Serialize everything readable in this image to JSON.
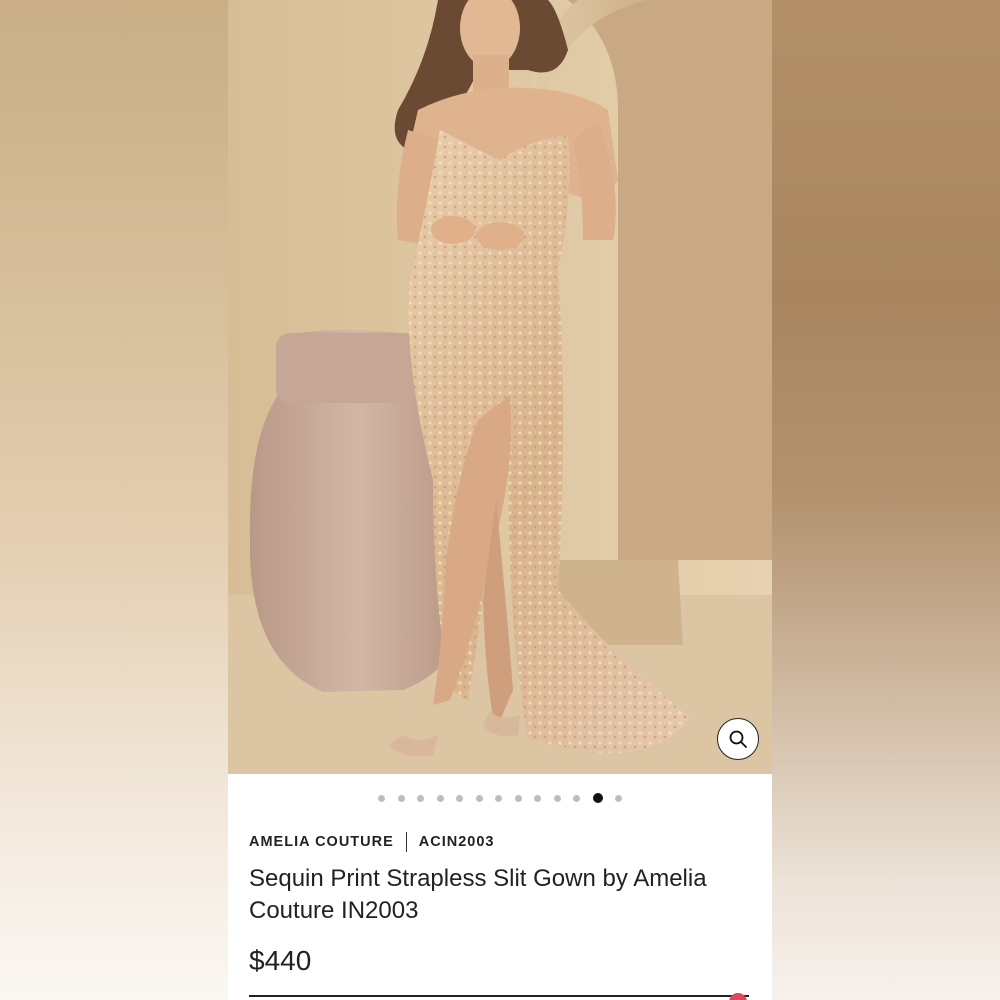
{
  "product": {
    "brand": "AMELIA COUTURE",
    "sku": "ACIN2003",
    "title": "Sequin Print Strapless Slit Gown by Amelia Couture IN2003",
    "price": "$440"
  },
  "gallery": {
    "image_count": 13,
    "active_index": 11,
    "zoom_icon": "search-icon"
  },
  "colors": {
    "dot_inactive": "#bdbdbd",
    "dot_active": "#111111",
    "accent": "#e0465e"
  }
}
